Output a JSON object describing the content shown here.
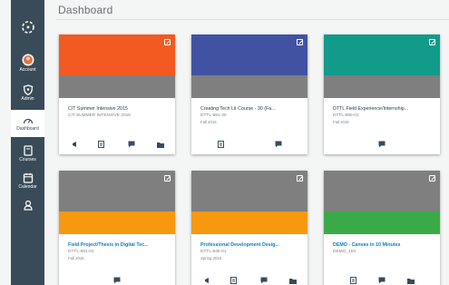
{
  "header": {
    "title": "Dashboard"
  },
  "nav": {
    "items": [
      {
        "label": ""
      },
      {
        "label": "Account"
      },
      {
        "label": "Admin"
      },
      {
        "label": "Dashboard"
      },
      {
        "label": "Courses"
      },
      {
        "label": "Calendar"
      },
      {
        "label": ""
      }
    ]
  },
  "colors": {
    "nav_bg": "#394b58",
    "orange_red": "#f25a22",
    "blue": "#4152a2",
    "teal": "#129a8a",
    "gray": "#7f7f7f",
    "orange": "#f8980e",
    "green": "#3aaa48",
    "link": "#0c7dc9"
  },
  "cards": [
    {
      "title": "CIT Summer Intensive 2015",
      "code": "CIT SUMMER INTENSIVE 2015",
      "term": ""
    },
    {
      "title": "Creating Tech Lit Course - 30 (Fa...",
      "code": "DTTL-691-30",
      "term": "Fall 2015"
    },
    {
      "title": "DTTL Field Experience/Internship...",
      "code": "DTTL-690-01",
      "term": "Fall 2015"
    },
    {
      "title": "Field Project/Thesis in Digital Tec...",
      "code": "DTTL-691-01",
      "term": "Fall 2015"
    },
    {
      "title": "Professional Development Desig...",
      "code": "DTTL-645-01",
      "term": "Spring 2016"
    },
    {
      "title": "DEMO - Canvas in 10 Minutes",
      "code": "DEMO_104",
      "term": ""
    }
  ]
}
